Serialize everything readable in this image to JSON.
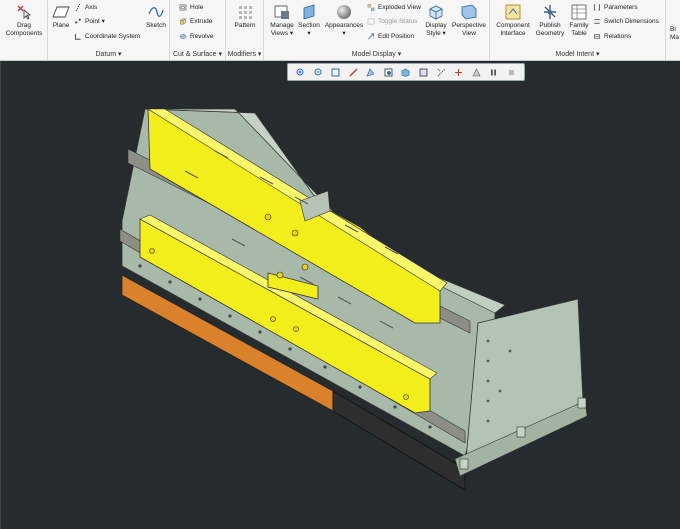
{
  "ribbon": {
    "operations": {
      "drag_components": "Drag\nComponents"
    },
    "datum": {
      "label": "Datum ▾",
      "plane": "Plane",
      "axis": "Axis",
      "point": "Point ▾",
      "coordinate_system": "Coordinate System",
      "sketch": "Sketch"
    },
    "cut_surface": {
      "label": "Cut & Surface ▾",
      "hole": "Hole",
      "extrude": "Extrude",
      "revolve": "Revolve"
    },
    "modifiers": {
      "label": "Modifiers ▾",
      "pattern": "Pattern"
    },
    "model_display": {
      "label": "Model Display ▾",
      "manage_views": "Manage\nViews ▾",
      "section": "Section\n▾",
      "appearances": "Appearances\n▾",
      "exploded_view": "Exploded View",
      "toggle_status": "Toggle Status",
      "edit_position": "Edit Position",
      "display_style": "Display\nStyle ▾",
      "perspective_view": "Perspective\nView"
    },
    "model_intent": {
      "label": "Model Intent ▾",
      "component_interface": "Component\nInterface",
      "publish_geometry": "Publish\nGeometry",
      "family_table": "Family\nTable",
      "parameters": "Parameters",
      "switch_dimensions": "Switch Dimensions",
      "relations": "Relations"
    },
    "overflow": {
      "bl_label": "Bl\nMa"
    }
  },
  "graphics_toolbar": {
    "icons": [
      "zoom-in-icon",
      "zoom-out-icon",
      "refit-icon",
      "repaint-icon",
      "orient-icon",
      "saved-views-icon",
      "display-style-icon",
      "view-manager-icon",
      "datum-display-icon",
      "spin-center-icon",
      "annotation-display-icon",
      "pause-icon",
      "stop-icon"
    ]
  },
  "colors": {
    "viewport_bg": "#262b2e",
    "yellow_part": "#f2ee1c",
    "frame": "#a8b8a8",
    "orange_strip": "#d9822b",
    "dark_strip": "#2a2a2a"
  }
}
